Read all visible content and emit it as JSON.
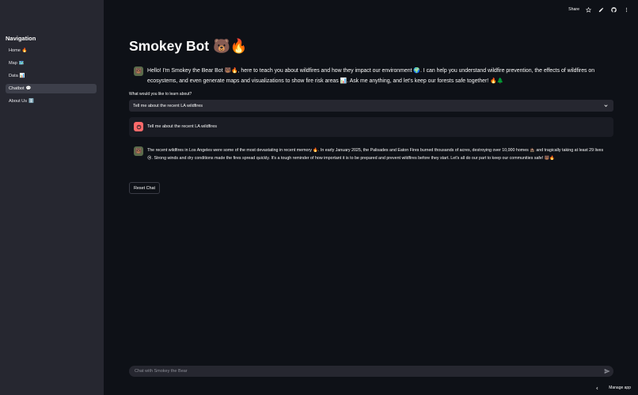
{
  "sidebar": {
    "title": "Navigation",
    "items": [
      {
        "label": "Home",
        "emoji": "🔥"
      },
      {
        "label": "Map",
        "emoji": "🗺️"
      },
      {
        "label": "Data",
        "emoji": "📊"
      },
      {
        "label": "Chatbot",
        "emoji": "💬"
      },
      {
        "label": "About Us",
        "emoji": "ℹ️"
      }
    ],
    "active_index": 3
  },
  "topbar": {
    "share_label": "Share",
    "icons": [
      "star-icon",
      "edit-icon",
      "github-icon",
      "more-icon"
    ]
  },
  "main": {
    "title": "Smokey Bot 🐻🔥",
    "intro_message": "Hello! I'm Smokey the Bear Bot 🐻🔥, here to teach you about wildfires and how they impact our environment 🌍. I can help you understand wildfire prevention, the effects of wildfires on ecosystems, and even generate maps and visualizations to show fire risk areas 📊. Ask me anything, and let's keep our forests safe together! 🔥🌲",
    "select_label": "What would you like to learn about?",
    "select_value": "Tell me about the recent LA wildfires",
    "user_message": "Tell me about the recent LA wildfires",
    "bot_response": "The recent wildfires in Los Angeles were some of the most devastating in recent memory 🔥. In early January 2025, the Palisades and Eaton Fires burned thousands of acres, destroying over 10,000 homes 🏚️ and tragically taking at least 29 lives 😢. Strong winds and dry conditions made the fires spread quickly. It's a tough reminder of how important it is to be prepared and prevent wildfires before they start. Let's all do our part to keep our communities safe! 🐻🔥",
    "reset_label": "Reset Chat"
  },
  "chat_input": {
    "placeholder": "Chat with Smokey the Bear"
  },
  "footer": {
    "manage_label": "Manage app"
  },
  "colors": {
    "background": "#0e1117",
    "sidebar": "#262730",
    "user_avatar": "#ff6a6a"
  }
}
